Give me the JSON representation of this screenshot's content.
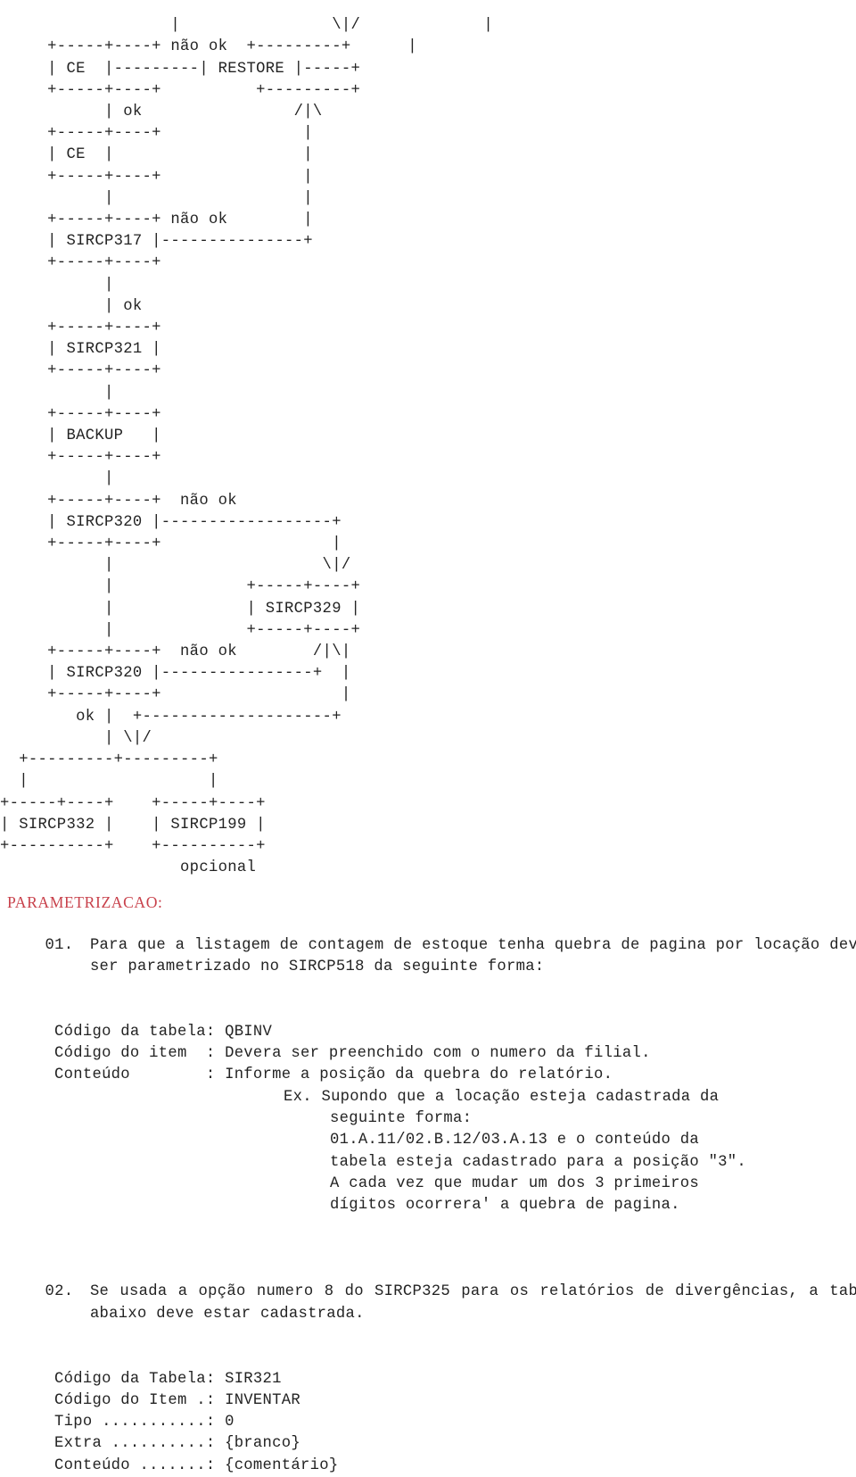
{
  "document": {
    "type": "ascii-flowchart-manual-page",
    "language": "pt-BR"
  },
  "diagram": {
    "name": "fluxo-sircp",
    "nodes": [
      "CE",
      "RESTORE",
      "CE",
      "SIRCP317",
      "SIRCP321",
      "BACKUP",
      "SIRCP320",
      "SIRCP329",
      "SIRCP320",
      "SIRCP332",
      "SIRCP199"
    ],
    "edge_labels": [
      "não ok",
      "ok",
      "não ok",
      "ok",
      "não ok",
      "não ok",
      "ok"
    ],
    "annotations": [
      "opcional"
    ],
    "art": "                  |                \\|/             |\n     +-----+----+ não ok  +---------+      |\n     | CE  |---------| RESTORE |-----+\n     +-----+----+          +---------+\n           | ok                /|\\\n     +-----+----+               |\n     | CE  |                    |\n     +-----+----+               |\n           |                    |\n     +-----+----+ não ok        |\n     | SIRCP317 |---------------+\n     +-----+----+\n           |\n           | ok\n     +-----+----+\n     | SIRCP321 |\n     +-----+----+\n           |\n     +-----+----+\n     | BACKUP   |\n     +-----+----+\n           |\n     +-----+----+  não ok\n     | SIRCP320 |------------------+\n     +-----+----+                  |\n           |                      \\|/\n           |              +-----+----+\n           |              | SIRCP329 |\n           |              +-----+----+\n     +-----+----+  não ok        /|\\|\n     | SIRCP320 |----------------+  |\n     +-----+----+                   |\n        ok |  +--------------------+\n           | \\|/\n  +---------+---------+\n  |                   |\n+-----+----+    +-----+----+\n| SIRCP332 |    | SIRCP199 |\n+----------+    +----------+\n                   opcional"
  },
  "parametrizacao": {
    "heading": "PARAMETRIZACAO:",
    "item01": {
      "number": "01.",
      "text": "Para que a listagem de contagem de estoque tenha quebra de pagina por locação devera ser parametrizado no SIRCP518 da seguinte forma:",
      "fields": [
        {
          "label": "Código da tabela:",
          "value": "QBINV"
        },
        {
          "label": "Código do item  :",
          "value": "Devera ser preenchido com o numero da filial."
        },
        {
          "label": "Conteúdo        :",
          "value": "Informe a posição da quebra do relatório."
        }
      ],
      "example_intro": "Ex. Supondo que a locação esteja cadastrada da",
      "example_line2": "seguinte forma:",
      "example_line3": "01.A.11/02.B.12/03.A.13 e o conteúdo da",
      "example_line4": "tabela esteja cadastrado para a posição \"3\".",
      "example_line5": "A cada vez que mudar um dos 3 primeiros",
      "example_line6": "dígitos ocorrera' a quebra de pagina."
    },
    "item02": {
      "number": "02.",
      "text": "Se usada a opção numero 8 do SIRCP325 para os relatórios de divergências, a tabela abaixo deve estar cadastrada.",
      "fields": [
        {
          "label": "Código da Tabela:",
          "value": "SIR321"
        },
        {
          "label": "Código do Item .:",
          "value": "INVENTAR"
        },
        {
          "label": "Tipo ...........:",
          "value": "0"
        },
        {
          "label": "Extra ..........:",
          "value": "{branco}"
        },
        {
          "label": "Conteúdo .......:",
          "value": "{comentário}"
        }
      ]
    }
  },
  "colors": {
    "heading_red": "#c8414b",
    "body_text": "#232323",
    "background": "#ffffff"
  }
}
